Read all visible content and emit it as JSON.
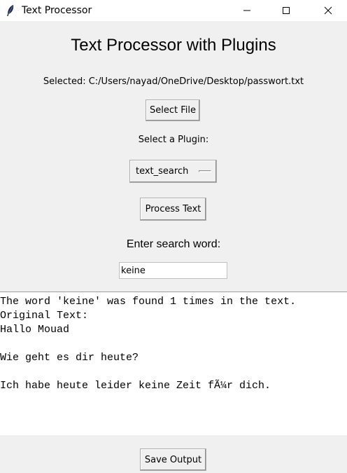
{
  "window": {
    "title": "Text Processor",
    "minimize_icon": "minimize-icon",
    "maximize_icon": "maximize-icon",
    "close_icon": "close-icon",
    "app_icon": "feather-icon"
  },
  "main": {
    "heading": "Text Processor with Plugins",
    "selected_label": "Selected: C:/Users/nayad/OneDrive/Desktop/passwort.txt",
    "select_file_button": "Select File",
    "plugin_label": "Select a Plugin:",
    "plugin_selected": "text_search",
    "process_button": "Process Text",
    "search_label": "Enter search word:",
    "search_value": "keine"
  },
  "output": {
    "text": "The word 'keine' was found 1 times in the text.\nOriginal Text:\nHallo Mouad\n\nWie geht es dir heute?\n\nIch habe heute leider keine Zeit fÃ¼r dich."
  },
  "footer": {
    "save_button": "Save Output"
  }
}
